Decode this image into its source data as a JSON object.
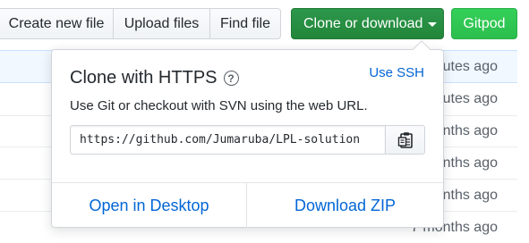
{
  "toolbar": {
    "create_new_file": "Create new file",
    "upload_files": "Upload files",
    "find_file": "Find file",
    "clone_or_download": "Clone or download",
    "gitpod": "Gitpod"
  },
  "file_table": {
    "rows": [
      {
        "age": "utes ago"
      },
      {
        "age": "utes ago"
      },
      {
        "age": "nths ago"
      },
      {
        "age": "nths ago"
      },
      {
        "age": "nths ago"
      },
      {
        "age": "7 months ago"
      }
    ]
  },
  "clone_popover": {
    "title": "Clone with HTTPS",
    "help_glyph": "?",
    "use_ssh_link": "Use SSH",
    "description": "Use Git or checkout with SVN using the web URL.",
    "url_value": "https://github.com/Jumaruba/LPL-solution",
    "open_in_desktop": "Open in Desktop",
    "download_zip": "Download ZIP"
  },
  "colors": {
    "accent_blue": "#0366d6",
    "clone_green": "#28a745",
    "gitpod_green": "#34d058"
  },
  "icons": {
    "help": "question-circle-icon",
    "copy": "clipboard-icon",
    "caret": "caret-down-icon"
  }
}
